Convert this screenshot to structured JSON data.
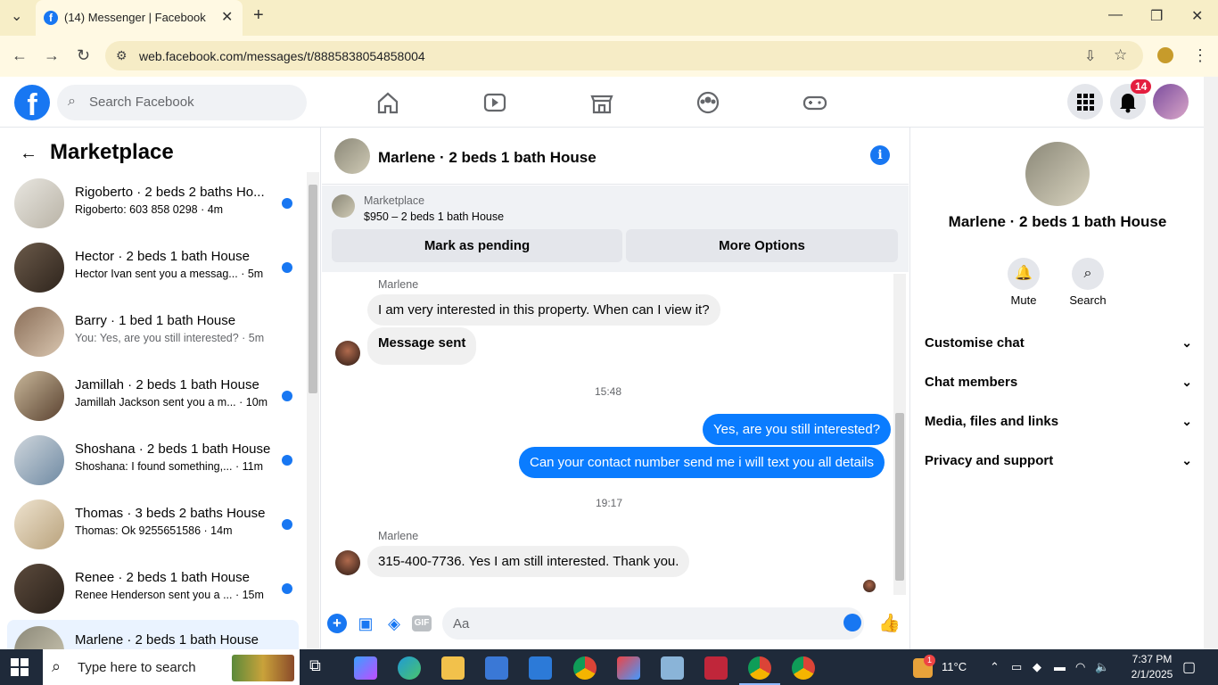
{
  "browser": {
    "tab_title": "(14) Messenger | Facebook",
    "url": "web.facebook.com/messages/t/8885838054858004"
  },
  "fb": {
    "search_placeholder": "Search Facebook",
    "notif_count": "14"
  },
  "sidebar": {
    "title": "Marketplace",
    "conversations": [
      {
        "name": "Rigoberto · 2 beds 2 baths Ho...",
        "preview": "Rigoberto: 603 858 0298 · 4m",
        "unread": true
      },
      {
        "name": "Hector · 2 beds 1 bath House",
        "preview": "Hector Ivan sent you a messag... · 5m",
        "unread": true
      },
      {
        "name": "Barry · 1 bed 1 bath House",
        "preview": "You: Yes, are you still interested? · 5m",
        "unread": false
      },
      {
        "name": "Jamillah · 2 beds 1 bath House",
        "preview": "Jamillah Jackson sent you a m... · 10m",
        "unread": true
      },
      {
        "name": "Shoshana · 2 beds 1 bath House",
        "preview": "Shoshana: I found something,... · 11m",
        "unread": true
      },
      {
        "name": "Thomas · 3 beds 2 baths House",
        "preview": "Thomas: Ok 9255651586 · 14m",
        "unread": true
      },
      {
        "name": "Renee · 2 beds 1 bath House",
        "preview": "Renee Henderson sent you a ... · 15m",
        "unread": true
      },
      {
        "name": "Marlene · 2 beds 1 bath House",
        "preview": "",
        "unread": false
      }
    ]
  },
  "chat": {
    "title": "Marlene · 2 beds 1 bath House",
    "marketplace_label": "Marketplace",
    "listing": "$950 – 2 beds 1 bath House",
    "mark_pending": "Mark as pending",
    "more_options": "More Options",
    "sender": "Marlene",
    "msg1": "I am very interested in this property.  When can I view it?",
    "msg2": "Message sent",
    "time1": "15:48",
    "out1": "Yes, are you still interested?",
    "out2": "Can your contact number send me i will text you all details",
    "time2": "19:17",
    "msg3": "315-400-7736.   Yes I am still interested. Thank you.",
    "composer_placeholder": "Aa"
  },
  "rpanel": {
    "name": "Marlene · 2 beds 1 bath House",
    "mute": "Mute",
    "search": "Search",
    "rows": [
      "Customise chat",
      "Chat members",
      "Media, files and links",
      "Privacy and support"
    ]
  },
  "taskbar": {
    "search_placeholder": "Type here to search",
    "temp": "11°C",
    "time": "7:37 PM",
    "date": "2/1/2025",
    "weather_badge": "1"
  },
  "colors": {
    "fb_blue": "#1877f2",
    "out_bubble": "#0a7cff",
    "chrome_bar": "#f7eec7"
  }
}
